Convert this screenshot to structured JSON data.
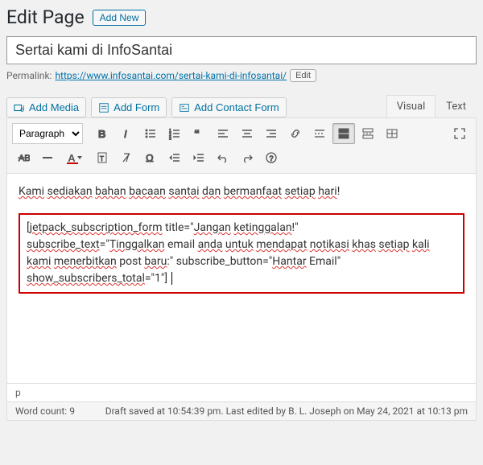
{
  "header": {
    "title": "Edit Page",
    "add_new": "Add New"
  },
  "title_field": {
    "value": "Sertai kami di InfoSantai"
  },
  "permalink": {
    "label": "Permalink:",
    "url_base": "https://www.infosantai.com/",
    "url_slug": "sertai-kami-di-infosantai/",
    "edit": "Edit"
  },
  "media_buttons": {
    "add_media": "Add Media",
    "add_form": "Add Form",
    "add_contact_form": "Add Contact Form"
  },
  "tabs": {
    "visual": "Visual",
    "text": "Text"
  },
  "toolbar": {
    "format": "Paragraph"
  },
  "content": {
    "intro_words": [
      "Kami",
      "sediakan",
      "bahan",
      "bacaan",
      "santai",
      "dan",
      "bermanfaat",
      "setiap",
      "hari"
    ],
    "intro_tail": "!",
    "shortcode_lines": [
      {
        "segments": [
          {
            "t": "[",
            "sp": false
          },
          {
            "t": "jetpack_subscription_form",
            "sp": true
          },
          {
            "t": " title=\"",
            "sp": false
          },
          {
            "t": "Jangan",
            "sp": true
          },
          {
            "t": " ",
            "sp": false
          },
          {
            "t": "ketinggalan",
            "sp": true
          },
          {
            "t": "!\"",
            "sp": false
          }
        ]
      },
      {
        "segments": [
          {
            "t": "subscribe_text",
            "sp": true
          },
          {
            "t": "=\"",
            "sp": false
          },
          {
            "t": "Tinggalkan",
            "sp": true
          },
          {
            "t": " email ",
            "sp": false
          },
          {
            "t": "anda",
            "sp": true
          },
          {
            "t": " ",
            "sp": false
          },
          {
            "t": "untuk",
            "sp": true
          },
          {
            "t": " ",
            "sp": false
          },
          {
            "t": "mendapat",
            "sp": true
          },
          {
            "t": " ",
            "sp": false
          },
          {
            "t": "notikasi",
            "sp": true
          },
          {
            "t": " ",
            "sp": false
          },
          {
            "t": "khas",
            "sp": true
          },
          {
            "t": " ",
            "sp": false
          },
          {
            "t": "setiap",
            "sp": true
          },
          {
            "t": " ",
            "sp": false
          },
          {
            "t": "kali",
            "sp": true
          }
        ]
      },
      {
        "segments": [
          {
            "t": "kami",
            "sp": true
          },
          {
            "t": " ",
            "sp": false
          },
          {
            "t": "menerbitkan",
            "sp": true
          },
          {
            "t": " post ",
            "sp": false
          },
          {
            "t": "baru",
            "sp": true
          },
          {
            "t": ":\" subscribe_button=\"",
            "sp": false
          },
          {
            "t": "Hantar",
            "sp": true
          },
          {
            "t": " Email\"",
            "sp": false
          }
        ]
      },
      {
        "segments": [
          {
            "t": "show_subscribers_total",
            "sp": true
          },
          {
            "t": "=\"1\"]",
            "sp": false
          }
        ],
        "cursor": true
      }
    ]
  },
  "path": "p",
  "status": {
    "word_count_label": "Word count:",
    "word_count": "9",
    "saved": "Draft saved at 10:54:39 pm. Last edited by B. L. Joseph on May 24, 2021 at 10:13 pm"
  }
}
